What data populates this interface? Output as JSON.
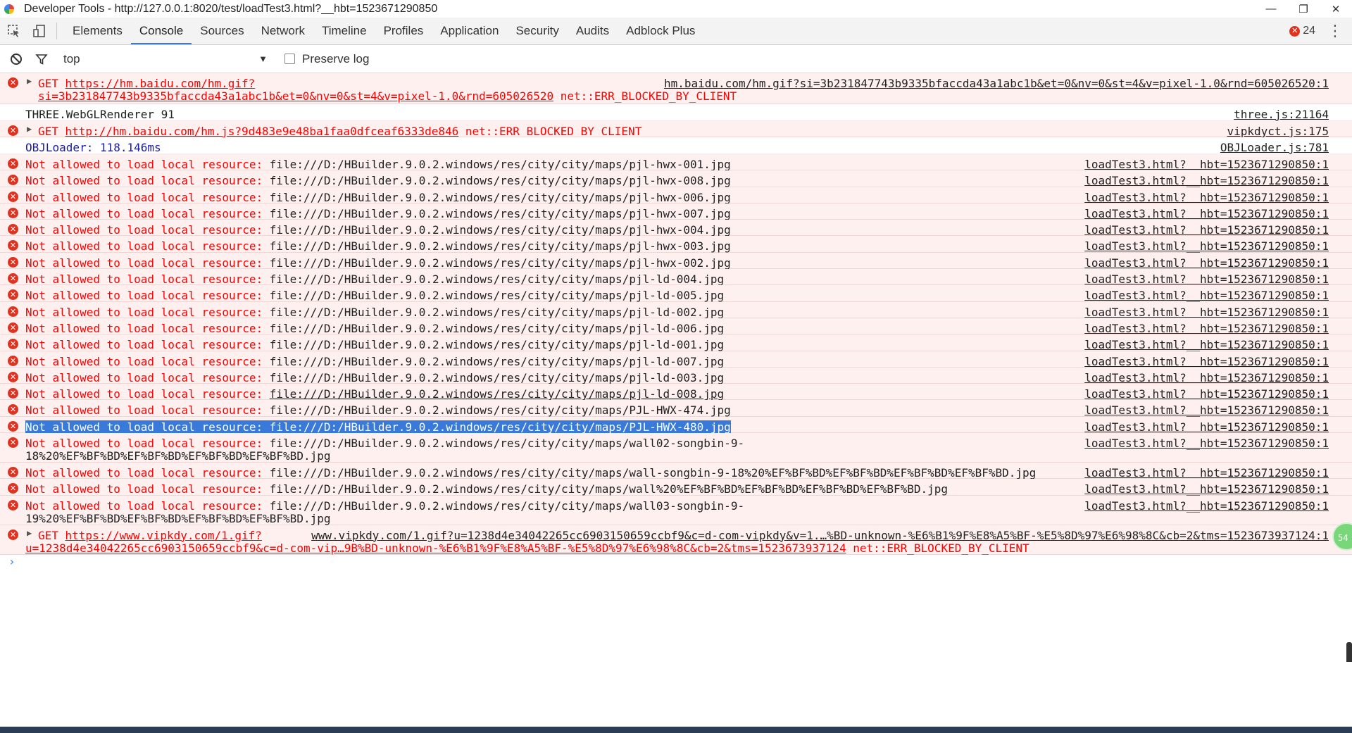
{
  "window": {
    "title": "Developer Tools - http://127.0.0.1:8020/test/loadTest3.html?__hbt=1523671290850",
    "minimize": "—",
    "restore": "❐",
    "close": "✕"
  },
  "tabs": [
    "Elements",
    "Console",
    "Sources",
    "Network",
    "Timeline",
    "Profiles",
    "Application",
    "Security",
    "Audits",
    "Adblock Plus"
  ],
  "active_tab": "Console",
  "error_count": "24",
  "filter": {
    "context": "top",
    "preserve_log_label": "Preserve log",
    "preserve_log_checked": false
  },
  "messages": {
    "m0": {
      "method": "GET ",
      "url1": "https://hm.baidu.com/hm.gif?",
      "url2": "si=3b231847743b9335bfaccda43a1abc1b&et=0&nv=0&st=4&v=pixel-1.0&rnd=605026520",
      "status": " net::ERR_BLOCKED_BY_CLIENT",
      "source": "hm.baidu.com/hm.gif?si=3b231847743b9335bfaccda43a1abc1b&et=0&nv=0&st=4&v=pixel-1.0&rnd=605026520:1"
    },
    "m1": {
      "text": "THREE.WebGLRenderer 91",
      "source": "three.js:21164"
    },
    "m2": {
      "method": "GET ",
      "url": "http://hm.baidu.com/hm.js?9d483e9e48ba1faa0dfceaf6333de846",
      "status": " net::ERR_BLOCKED_BY_CLIENT",
      "source": "vipkdyct.js:175"
    },
    "m3": {
      "text": "OBJLoader: 118.146ms",
      "source": "OBJLoader.js:781"
    },
    "prefix": "Not allowed to load local resource: ",
    "source_local": "loadTest3.html?__hbt=1523671290850:1",
    "local": [
      "file:///D:/HBuilder.9.0.2.windows/res/city/city/maps/pjl-hwx-001.jpg",
      "file:///D:/HBuilder.9.0.2.windows/res/city/city/maps/pjl-hwx-008.jpg",
      "file:///D:/HBuilder.9.0.2.windows/res/city/city/maps/pjl-hwx-006.jpg",
      "file:///D:/HBuilder.9.0.2.windows/res/city/city/maps/pjl-hwx-007.jpg",
      "file:///D:/HBuilder.9.0.2.windows/res/city/city/maps/pjl-hwx-004.jpg",
      "file:///D:/HBuilder.9.0.2.windows/res/city/city/maps/pjl-hwx-003.jpg",
      "file:///D:/HBuilder.9.0.2.windows/res/city/city/maps/pjl-hwx-002.jpg",
      "file:///D:/HBuilder.9.0.2.windows/res/city/city/maps/pjl-ld-004.jpg",
      "file:///D:/HBuilder.9.0.2.windows/res/city/city/maps/pjl-ld-005.jpg",
      "file:///D:/HBuilder.9.0.2.windows/res/city/city/maps/pjl-ld-002.jpg",
      "file:///D:/HBuilder.9.0.2.windows/res/city/city/maps/pjl-ld-006.jpg",
      "file:///D:/HBuilder.9.0.2.windows/res/city/city/maps/pjl-ld-001.jpg",
      "file:///D:/HBuilder.9.0.2.windows/res/city/city/maps/pjl-ld-007.jpg",
      "file:///D:/HBuilder.9.0.2.windows/res/city/city/maps/pjl-ld-003.jpg",
      "file:///D:/HBuilder.9.0.2.windows/res/city/city/maps/pjl-ld-008.jpg",
      "file:///D:/HBuilder.9.0.2.windows/res/city/city/maps/PJL-HWX-474.jpg",
      "file:///D:/HBuilder.9.0.2.windows/res/city/city/maps/PJL-HWX-480.jpg"
    ],
    "wall02_l1": "file:///D:/HBuilder.9.0.2.windows/res/city/city/maps/wall02-songbin-9-",
    "wall02_l2": "18%20%EF%BF%BD%EF%BF%BD%EF%BF%BD%EF%BF%BD.jpg",
    "wall_songbin": "file:///D:/HBuilder.9.0.2.windows/res/city/city/maps/wall-songbin-9-18%20%EF%BF%BD%EF%BF%BD%EF%BF%BD%EF%BF%BD.jpg",
    "wall_plain": "file:///D:/HBuilder.9.0.2.windows/res/city/city/maps/wall%20%EF%BF%BD%EF%BF%BD%EF%BF%BD%EF%BF%BD.jpg",
    "wall03_l1": "file:///D:/HBuilder.9.0.2.windows/res/city/city/maps/wall03-songbin-9-",
    "wall03_l2": "19%20%EF%BF%BD%EF%BF%BD%EF%BF%BD%EF%BF%BD.jpg",
    "last": {
      "method": "GET ",
      "url1": "https://www.vipkdy.com/1.gif?",
      "url2": "u=1238d4e34042265cc6903150659ccbf9&c=d-com-vip…9B%BD-unknown-%E6%B1%9F%E8%A5%BF-%E5%8D%97%E6%98%8C&cb=2&tms=1523673937124",
      "status": " net::ERR_BLOCKED_BY_CLIENT",
      "source": "www.vipkdy.com/1.gif?u=1238d4e34042265cc6903150659ccbf9&c=d-com-vipkdy&v=1.…%BD-unknown-%E6%B1%9F%E8%A5%BF-%E5%8D%97%E6%98%8C&cb=2&tms=1523673937124:1"
    }
  },
  "prompt_symbol": "›",
  "badge_text": "54",
  "colors": {
    "error_text": "#ff0000",
    "error_bg": "#fff0f0",
    "accent": "#3879d9",
    "info_text": "#1a1aa6"
  }
}
